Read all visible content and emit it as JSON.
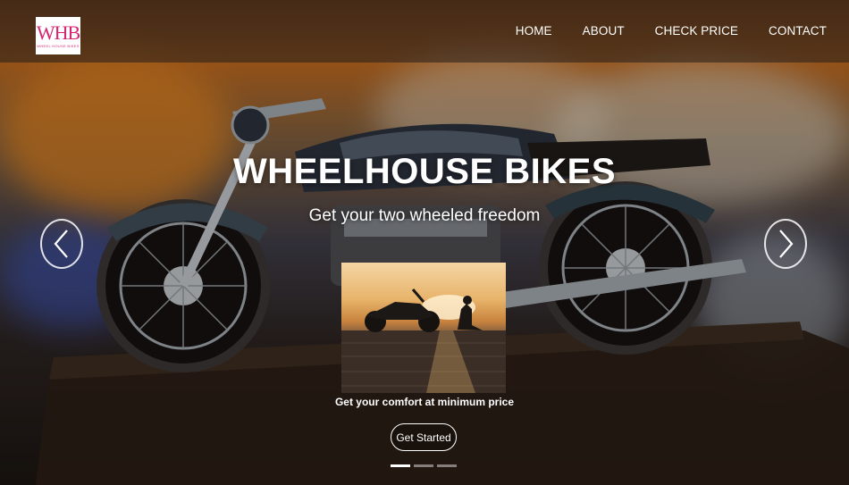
{
  "nav": {
    "logo": {
      "mark": "WHB",
      "subtext": "WHEEL HOUSE BIKES"
    },
    "links": [
      {
        "label": "HOME"
      },
      {
        "label": "ABOUT"
      },
      {
        "label": "CHECK PRICE"
      },
      {
        "label": "CONTACT"
      }
    ]
  },
  "hero": {
    "title": "WHEELHOUSE BIKES",
    "subtitle": "Get your two wheeled freedom",
    "caption": "Get your comfort at minimum price",
    "cta_label": "Get Started"
  },
  "carousel": {
    "prev_icon": "chevron-left-icon",
    "next_icon": "chevron-right-icon",
    "indicator_count": 3,
    "active_index": 0
  }
}
